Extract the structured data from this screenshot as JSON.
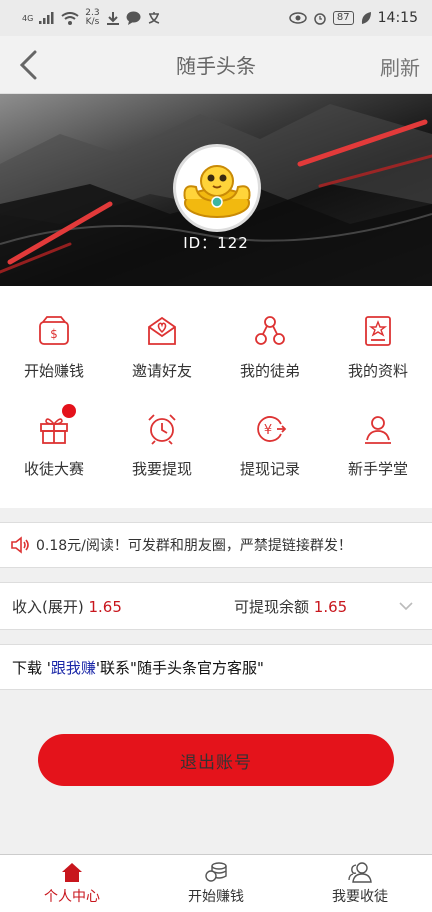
{
  "status_bar": {
    "signal": "4G",
    "net_speed_value": "2.3",
    "net_speed_unit": "K/s",
    "battery": "87",
    "time": "14:15"
  },
  "header": {
    "title": "随手头条",
    "refresh_label": "刷新"
  },
  "profile": {
    "id_text": "ID：122"
  },
  "grid": [
    {
      "label": "开始赚钱",
      "icon": "money-bag-icon"
    },
    {
      "label": "邀请好友",
      "icon": "envelope-heart-icon"
    },
    {
      "label": "我的徒弟",
      "icon": "org-chart-icon"
    },
    {
      "label": "我的资料",
      "icon": "profile-card-icon"
    },
    {
      "label": "收徒大赛",
      "icon": "gift-icon"
    },
    {
      "label": "我要提现",
      "icon": "alarm-clock-icon"
    },
    {
      "label": "提现记录",
      "icon": "yuan-cycle-icon"
    },
    {
      "label": "新手学堂",
      "icon": "user-icon"
    }
  ],
  "notice": {
    "text": "0.18元/阅读！可发群和朋友圈，严禁提链接群发！"
  },
  "income": {
    "label": "收入(展开)",
    "value": "1.65",
    "withdrawable_label": "可提现余额",
    "withdrawable_value": "1.65"
  },
  "download": {
    "prefix": "下载 '",
    "app_name": "跟我赚",
    "suffix": "'联系\"随手头条官方客服\""
  },
  "logout_label": "退出账号",
  "bottom_nav": [
    {
      "label": "个人中心",
      "active": true
    },
    {
      "label": "开始赚钱",
      "active": false
    },
    {
      "label": "我要收徒",
      "active": false
    }
  ],
  "colors": {
    "accent": "#e4131b",
    "accent_text": "#c8161d",
    "link_blue": "#1a27a8"
  }
}
